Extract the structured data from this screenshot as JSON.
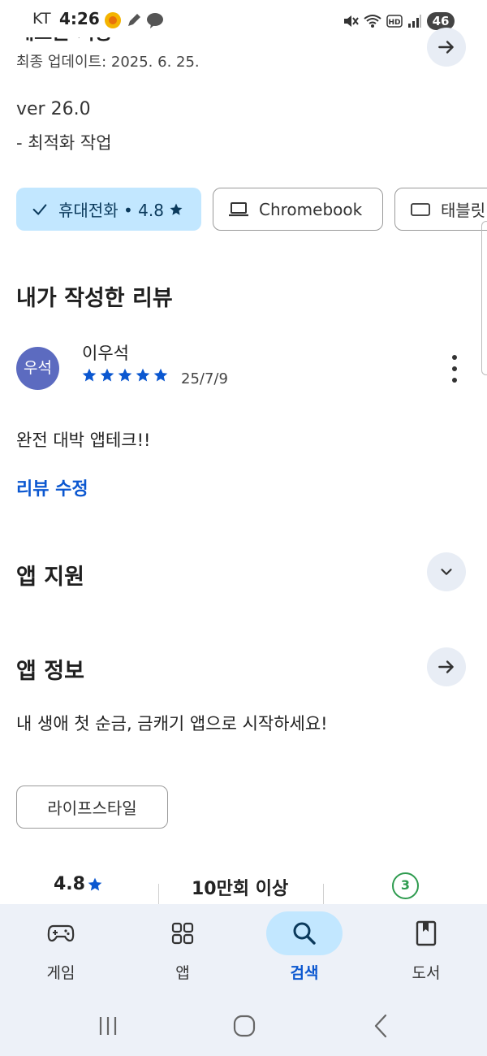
{
  "status_bar": {
    "carrier": "KT",
    "time": "4:26",
    "battery": "46",
    "notification_icons": [
      "deal-app-icon",
      "edit-icon",
      "kakaotalk-icon"
    ],
    "system_icons": [
      "mute-icon",
      "wifi-icon",
      "hd-icon",
      "signal-icon"
    ]
  },
  "whats_new": {
    "title": "새로운 기능",
    "updated": "최종 업데이트: 2025. 6. 25.",
    "version": "ver 26.0",
    "change_note": "- 최적화 작업"
  },
  "device_chips": [
    {
      "label": "휴대전화 • 4.8",
      "icon": "check-icon",
      "selected": true
    },
    {
      "label": "Chromebook",
      "icon": "laptop-icon",
      "selected": false
    },
    {
      "label": "태블릿",
      "icon": "tablet-icon",
      "selected": false
    }
  ],
  "my_review": {
    "heading": "내가 작성한 리뷰",
    "avatar_text": "우석",
    "reviewer_name": "이우석",
    "stars": 5,
    "date": "25/7/9",
    "text": "완전 대박 앱테크!!",
    "edit_label": "리뷰 수정"
  },
  "app_support": {
    "heading": "앱 지원"
  },
  "app_info": {
    "heading": "앱 정보",
    "description": "내 생애 첫 순금, 금캐기 앱으로 시작하세요!",
    "category": "라이프스타일"
  },
  "stats": {
    "rating": "4.8",
    "installs": "10만회 이상",
    "age_rating": "3"
  },
  "bottom_nav": [
    {
      "label": "게임",
      "icon": "gamepad-icon",
      "active": false
    },
    {
      "label": "앱",
      "icon": "apps-grid-icon",
      "active": false
    },
    {
      "label": "검색",
      "icon": "search-icon",
      "active": true
    },
    {
      "label": "도서",
      "icon": "book-icon",
      "active": false
    }
  ],
  "colors": {
    "accent": "#0b57d0",
    "chip_selected_bg": "#c2e7ff",
    "star": "#0b57d0",
    "avatar_bg": "#5c6bc0",
    "nav_bg": "#edf1f8"
  }
}
